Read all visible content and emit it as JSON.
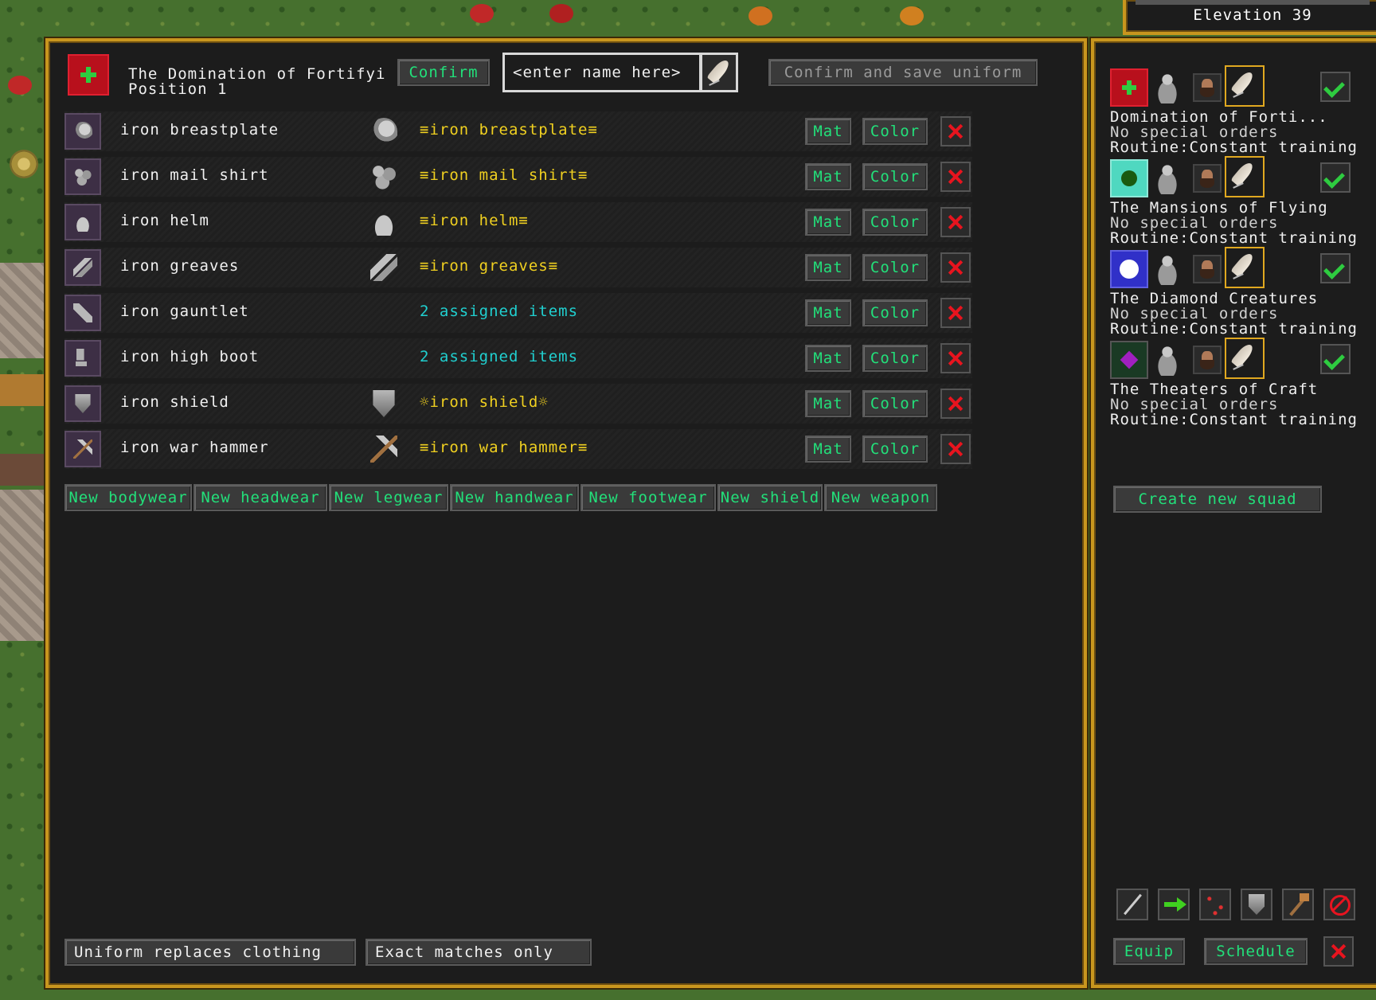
{
  "elevation": "Elevation 39",
  "header": {
    "squad_title_line1": "The Domination of Fortifyi",
    "squad_title_line2": "Position 1",
    "confirm_label": "Confirm",
    "uniform_name_placeholder": "<enter name here>",
    "confirm_save_label": "Confirm and save uniform"
  },
  "items": [
    {
      "name": "iron breastplate",
      "assigned": "≡iron breastplate≡",
      "assigned_color": "yellow",
      "mat": "Mat",
      "color": "Color",
      "icon": "breastplate-icon"
    },
    {
      "name": "iron mail shirt",
      "assigned": "≡iron mail shirt≡",
      "assigned_color": "yellow",
      "mat": "Mat",
      "color": "Color",
      "icon": "mail-shirt-icon"
    },
    {
      "name": "iron helm",
      "assigned": "≡iron helm≡",
      "assigned_color": "yellow",
      "mat": "Mat",
      "color": "Color",
      "icon": "helm-icon"
    },
    {
      "name": "iron greaves",
      "assigned": "≡iron greaves≡",
      "assigned_color": "yellow",
      "mat": "Mat",
      "color": "Color",
      "icon": "greaves-icon"
    },
    {
      "name": "iron gauntlet",
      "assigned": "2 assigned items",
      "assigned_color": "cyan",
      "mat": "Mat",
      "color": "Color",
      "icon": "gauntlet-icon"
    },
    {
      "name": "iron high boot",
      "assigned": "2 assigned items",
      "assigned_color": "cyan",
      "mat": "Mat",
      "color": "Color",
      "icon": "boot-icon"
    },
    {
      "name": "iron shield",
      "assigned": "☼iron shield☼",
      "assigned_color": "yellow",
      "mat": "Mat",
      "color": "Color",
      "icon": "shield-icon"
    },
    {
      "name": "iron war hammer",
      "assigned": "≡iron war hammer≡",
      "assigned_color": "yellow",
      "mat": "Mat",
      "color": "Color",
      "icon": "war-hammer-icon"
    }
  ],
  "new_buttons": [
    "New bodywear",
    "New headwear",
    "New legwear",
    "New handwear",
    "New footwear",
    "New shield",
    "New weapon"
  ],
  "footer": {
    "replaces_clothing": "Uniform replaces clothing",
    "exact_matches": "Exact matches only"
  },
  "squads": [
    {
      "name": "Domination of Forti...",
      "orders": "No special orders",
      "routine": "Routine:Constant training",
      "emblem": "red-cross"
    },
    {
      "name": "The Mansions of Flying",
      "orders": "No special orders",
      "routine": "Routine:Constant training",
      "emblem": "teal-circle"
    },
    {
      "name": "The Diamond Creatures",
      "orders": "No special orders",
      "routine": "Routine:Constant training",
      "emblem": "blue-white-circle"
    },
    {
      "name": "The Theaters of Craft",
      "orders": "No special orders",
      "routine": "Routine:Constant training",
      "emblem": "purple-diamond"
    }
  ],
  "sidebar": {
    "create_squad_label": "Create new squad",
    "equip_label": "Equip",
    "schedule_label": "Schedule"
  },
  "colors": {
    "frame": "#c8961e",
    "button_text": "#22e07a",
    "assigned_yellow": "#f0d020",
    "assigned_cyan": "#20d0d0",
    "delete_red": "#e8141e"
  }
}
